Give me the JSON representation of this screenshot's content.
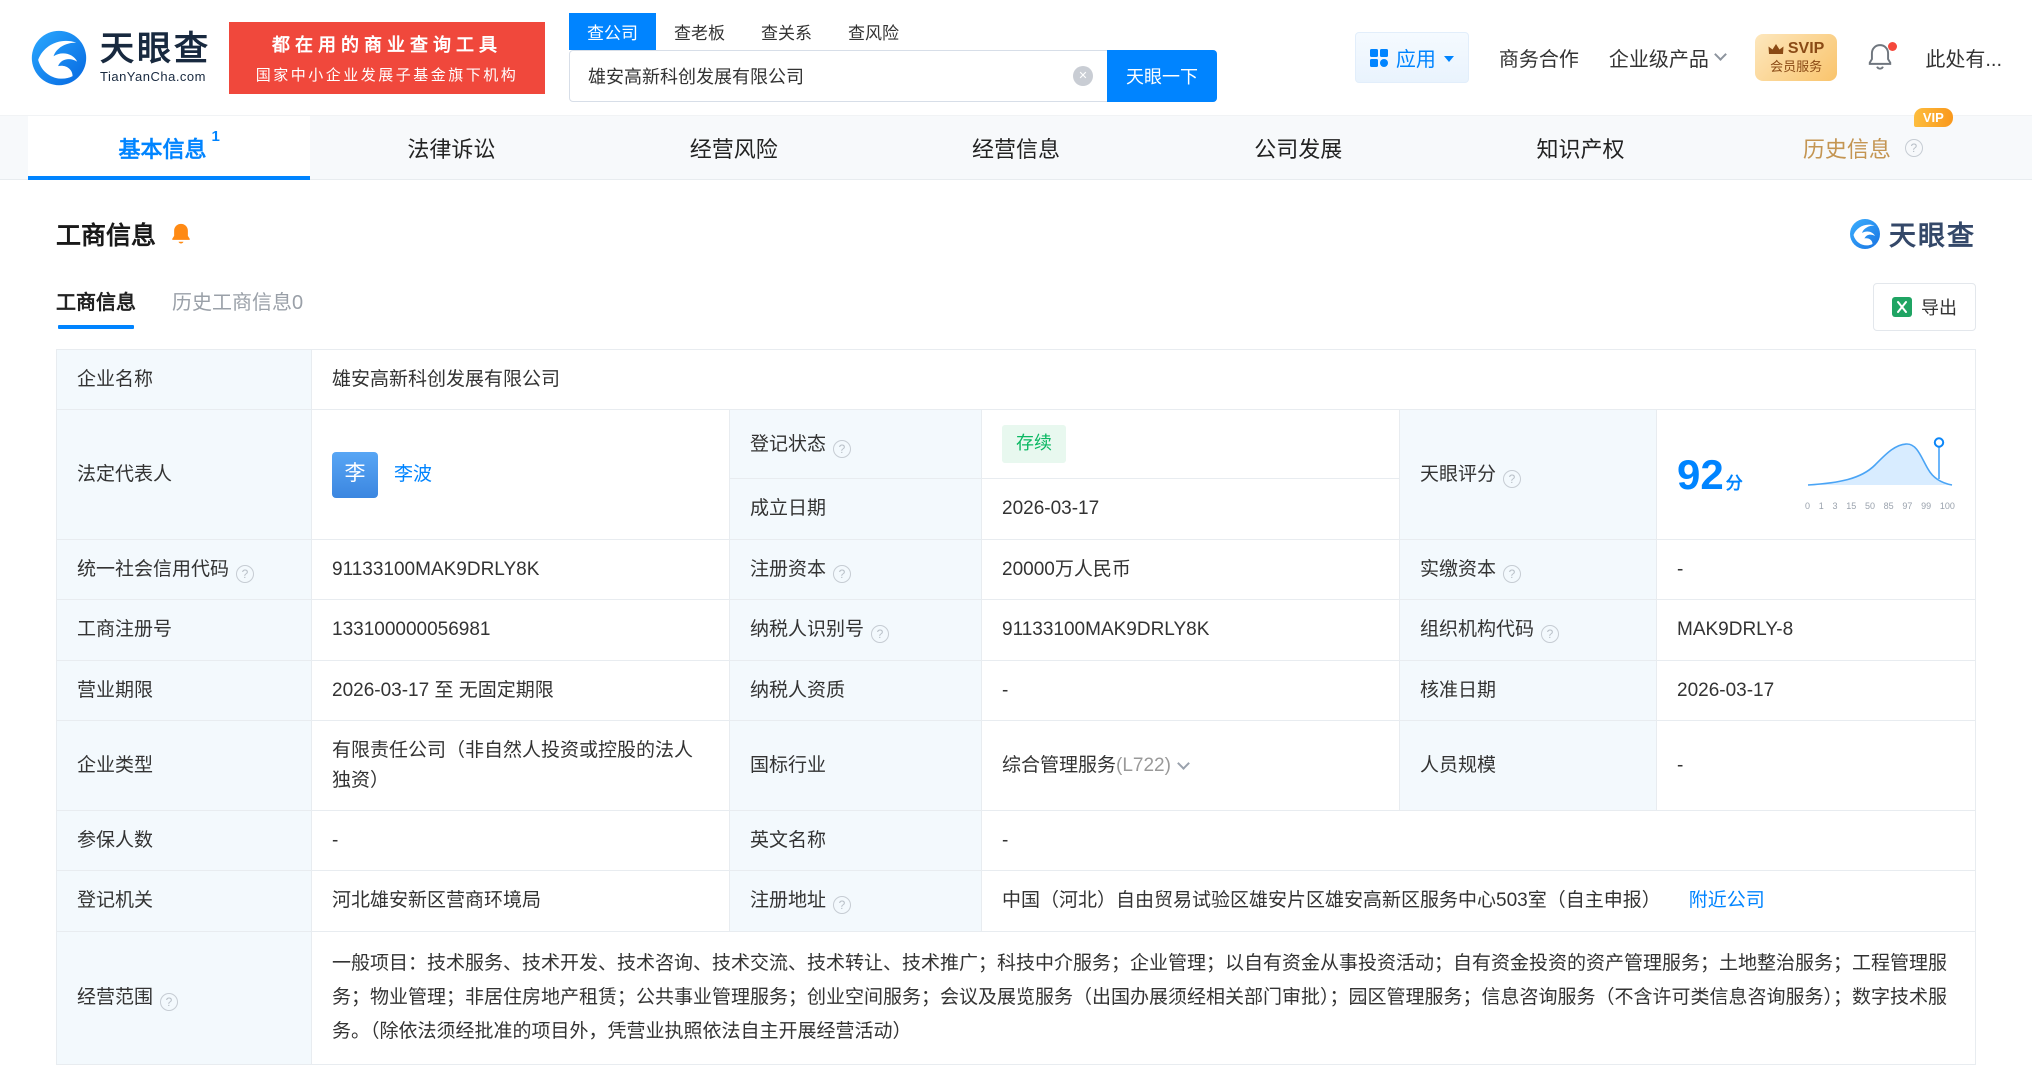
{
  "brand": {
    "name": "天眼查",
    "domain": "TianYanCha.com",
    "accent_color": "#0084ff"
  },
  "header": {
    "banner_line1": "都在用的商业查询工具",
    "banner_line2": "国家中小企业发展子基金旗下机构",
    "search_tabs": [
      {
        "label": "查公司"
      },
      {
        "label": "查老板"
      },
      {
        "label": "查关系"
      },
      {
        "label": "查风险"
      }
    ],
    "search_value": "雄安高新科创发展有限公司",
    "search_button": "天眼一下",
    "apps_label": "应用",
    "coop_label": "商务合作",
    "enterprise_label": "企业级产品",
    "svip_line1": "SVIP",
    "svip_line2": "会员服务",
    "user_label": "此处有..."
  },
  "tabs": [
    {
      "label": "基本信息",
      "count": "1"
    },
    {
      "label": "法律诉讼"
    },
    {
      "label": "经营风险"
    },
    {
      "label": "经营信息"
    },
    {
      "label": "公司发展"
    },
    {
      "label": "知识产权"
    },
    {
      "label": "历史信息",
      "vip": "VIP"
    }
  ],
  "section": {
    "title": "工商信息",
    "subtab_active": "工商信息",
    "subtab_history": "历史工商信息",
    "subtab_history_count": "0",
    "export_label": "导出"
  },
  "icons": {
    "question": "?",
    "clear": "✕"
  },
  "fields": {
    "company_name_label": "企业名称",
    "company_name": "雄安高新科创发展有限公司",
    "legal_rep_label": "法定代表人",
    "legal_rep_avatar_char": "李",
    "legal_rep_name": "李波",
    "reg_status_label": "登记状态",
    "reg_status_value": "存续",
    "establish_date_label": "成立日期",
    "establish_date_value": "2026-03-17",
    "score_label": "天眼评分",
    "credit_code_label": "统一社会信用代码",
    "credit_code_value": "91133100MAK9DRLY8K",
    "reg_capital_label": "注册资本",
    "reg_capital_value": "20000万人民币",
    "paid_capital_label": "实缴资本",
    "paid_capital_value": "-",
    "reg_no_label": "工商注册号",
    "reg_no_value": "133100000056981",
    "taxpayer_no_label": "纳税人识别号",
    "taxpayer_no_value": "91133100MAK9DRLY8K",
    "org_code_label": "组织机构代码",
    "org_code_value": "MAK9DRLY-8",
    "term_label": "营业期限",
    "term_value": "2026-03-17 至 无固定期限",
    "taxpayer_quality_label": "纳税人资质",
    "taxpayer_quality_value": "-",
    "approve_date_label": "核准日期",
    "approve_date_value": "2026-03-17",
    "company_type_label": "企业类型",
    "company_type_value": "有限责任公司（非自然人投资或控股的法人独资）",
    "industry_label": "国标行业",
    "industry_value": "综合管理服务",
    "industry_code": "(L722)",
    "staff_label": "人员规模",
    "staff_value": "-",
    "insured_label": "参保人数",
    "insured_value": "-",
    "en_name_label": "英文名称",
    "en_name_value": "-",
    "authority_label": "登记机关",
    "authority_value": "河北雄安新区营商环境局",
    "address_label": "注册地址",
    "address_value": "中国（河北）自由贸易试验区雄安片区雄安高新区服务中心503室（自主申报）",
    "nearby_label": "附近公司",
    "scope_label": "经营范围",
    "scope_value": "一般项目：技术服务、技术开发、技术咨询、技术交流、技术转让、技术推广；科技中介服务；企业管理；以自有资金从事投资活动；自有资金投资的资产管理服务；土地整治服务；工程管理服务；物业管理；非居住房地产租赁；公共事业管理服务；创业空间服务；会议及展览服务（出国办展须经相关部门审批）；园区管理服务；信息咨询服务（不含许可类信息咨询服务）；数字技术服务。（除依法须经批准的项目外，凭营业执照依法自主开展经营活动）"
  },
  "score_chart": {
    "type": "line",
    "value": 92,
    "unit": "分",
    "x_ticks": [
      "0",
      "1",
      "3",
      "15",
      "50",
      "85",
      "97",
      "99",
      "100"
    ]
  }
}
